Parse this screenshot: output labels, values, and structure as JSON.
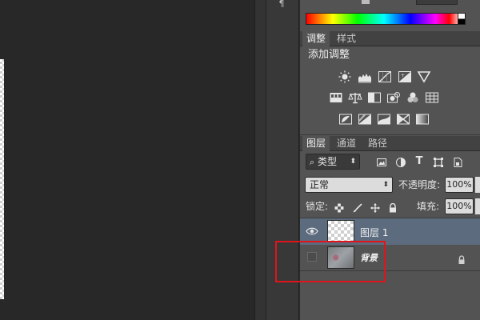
{
  "dock": {
    "icon": "paragraph-icon"
  },
  "adjustments_panel": {
    "tabs": [
      {
        "label": "调整",
        "active": true
      },
      {
        "label": "样式",
        "active": false
      }
    ],
    "heading": "添加调整",
    "rows": [
      [
        "brightness-contrast-icon",
        "levels-icon",
        "curves-icon",
        "exposure-icon",
        "vibrance-icon"
      ],
      [
        "hue-saturation-icon",
        "color-balance-icon",
        "black-white-icon",
        "photo-filter-icon",
        "channel-mixer-icon",
        "color-lookup-icon"
      ],
      [
        "invert-icon",
        "posterize-icon",
        "threshold-icon",
        "selective-color-icon",
        "gradient-map-icon"
      ]
    ]
  },
  "layers_panel": {
    "tabs": [
      {
        "label": "图层",
        "active": true
      },
      {
        "label": "通道",
        "active": false
      },
      {
        "label": "路径",
        "active": false
      }
    ],
    "filter": {
      "icon": "search-icon",
      "label": "类型"
    },
    "blend_mode": "正常",
    "opacity_label": "不透明度:",
    "opacity_value": "100%",
    "lock_label": "锁定:",
    "fill_label": "填充:",
    "fill_value": "100%",
    "layers": [
      {
        "name": "图层 1",
        "visible": true,
        "selected": true,
        "locked": false
      },
      {
        "name": "背景",
        "visible": false,
        "selected": false,
        "locked": true
      }
    ]
  },
  "colors": {
    "panel_bg": "#535353",
    "canvas_bg": "#282828",
    "selected_layer": "#5c6b7e",
    "highlight": "#e0141b"
  }
}
